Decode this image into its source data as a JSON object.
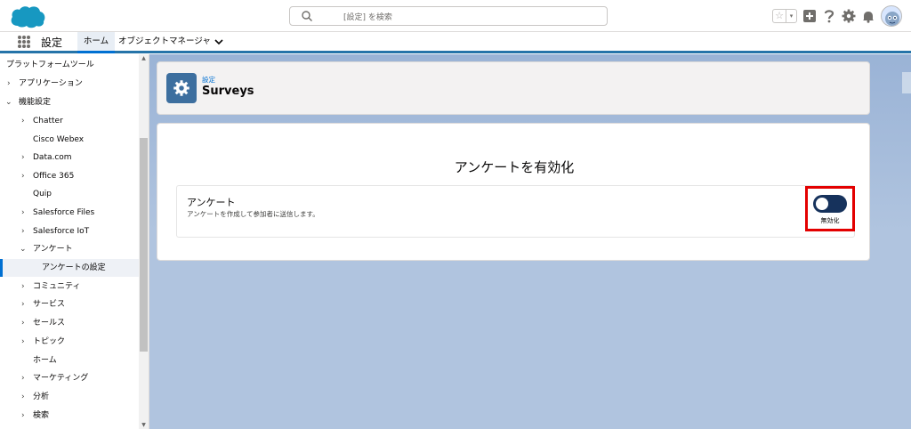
{
  "header": {
    "search_placeholder": "[設定] を検索"
  },
  "nav": {
    "app_name": "設定",
    "tabs": [
      {
        "label": "ホーム"
      },
      {
        "label": "オブジェクトマネージャ"
      }
    ]
  },
  "sidebar": {
    "items": [
      {
        "label": "プラットフォームツール"
      },
      {
        "label": "アプリケーション"
      },
      {
        "label": "機能設定"
      },
      {
        "label": "Chatter"
      },
      {
        "label": "Cisco Webex"
      },
      {
        "label": "Data.com"
      },
      {
        "label": "Office 365"
      },
      {
        "label": "Quip"
      },
      {
        "label": "Salesforce Files"
      },
      {
        "label": "Salesforce IoT"
      },
      {
        "label": "アンケート"
      },
      {
        "label": "アンケートの設定"
      },
      {
        "label": "コミュニティ"
      },
      {
        "label": "サービス"
      },
      {
        "label": "セールス"
      },
      {
        "label": "トピック"
      },
      {
        "label": "ホーム"
      },
      {
        "label": "マーケティング"
      },
      {
        "label": "分析"
      },
      {
        "label": "検索"
      }
    ]
  },
  "page": {
    "breadcrumb": "設定",
    "title": "Surveys"
  },
  "card": {
    "title": "アンケートを有効化",
    "setting_label": "アンケート",
    "setting_desc": "アンケートを作成して参加者に送信します。",
    "toggle_state": "無効化",
    "toggle_on": false
  },
  "colors": {
    "accent": "#0070d2",
    "toggle_off": "#16325c",
    "highlight": "#e30000"
  }
}
